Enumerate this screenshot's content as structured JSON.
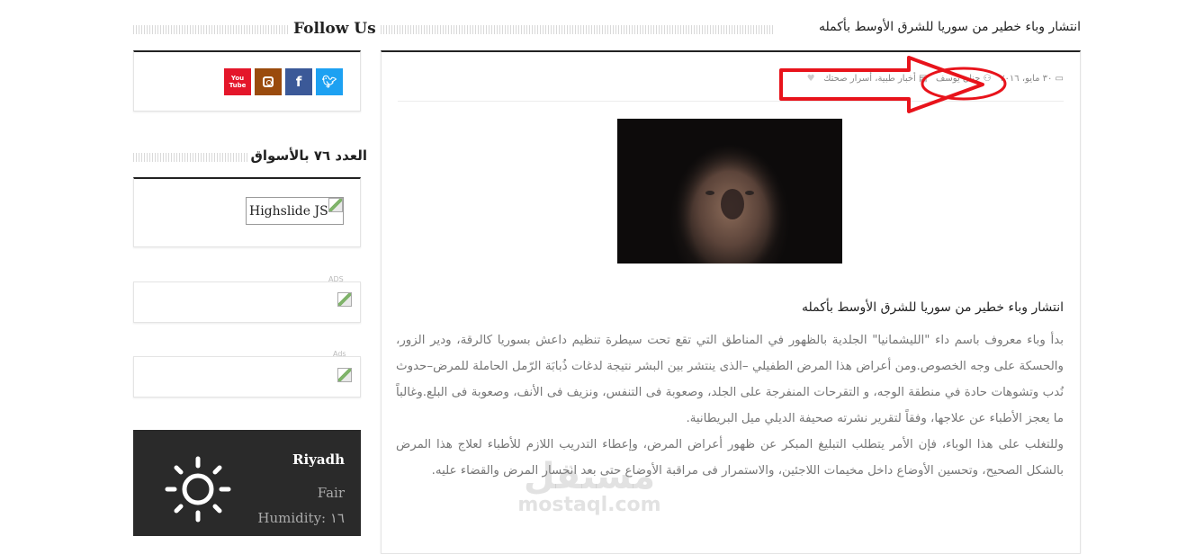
{
  "sidebar": {
    "follow_title": "Follow Us",
    "social": [
      {
        "name": "youtube",
        "label": "You Tube",
        "color": "#e4162a"
      },
      {
        "name": "instagram",
        "label": "◙",
        "color": "#9a4b0d"
      },
      {
        "name": "facebook",
        "label": "f",
        "color": "#3b5998"
      },
      {
        "name": "twitter",
        "label": "t",
        "color": "#1da1f2"
      }
    ],
    "issue_title": "العدد ٧٦ بالأسواق",
    "highslide_alt": "Highslide JS",
    "ads_label_1": "ADS",
    "ads_label_2": "Ads",
    "weather": {
      "city": "Riyadh",
      "condition": "Fair",
      "humidity": "Humidity: ١٦",
      "icon": "sun-icon"
    }
  },
  "article": {
    "header_title": "انتشار وباء خطير من سوريا للشرق الأوسط بأكمله",
    "date": "٣٠ مايو، ٢٠١٦",
    "author": "حنان يوسف",
    "categories": "أخبار طبية، أسرار صحتك",
    "inner_title": "انتشار وباء خطير من سوريا للشرق الأوسط بأكمله",
    "paragraphs": [
      "بدأ وباء معروف باسم داء \"الليشمانيا\" الجلدية بالظهور في المناطق التي تقع تحت سيطرة تنظيم داعش بسوريا كالرقة، ودير الزور، والحسكة على وجه الخصوص.ومن أعراض هذا المرض الطفيلي –الذى ينتشر بين البشر نتيجة لدغات ذُبابَة الرّمل الحاملة للمرض–حدوث نُدب وتشوهات حادة في منطقة الوجه، و التقرحات المنفرجة على الجلد، وصعوبة فى التنفس، ونزيف فى الأنف، وصعوبة فى البلع.وغالباً ما يعجز الأطباء عن علاجها، وفقاً لتقرير نشرته صحيفة الديلي ميل البريطانية.",
      "وللتغلب على هذا الوباء، فإن الأمر يتطلب التبليغ المبكر عن ظهور أعراض المرض، وإعطاء التدريب اللازم للأطباء لعلاج هذا المرض بالشكل الصحيح، وتحسين الأوضاع داخل مخيمات اللاجئين، والاستمرار فى مراقبة الأوضاع حتى بعد انحسار المرض والقضاء عليه."
    ]
  },
  "watermark": {
    "arabic": "مستقل",
    "latin": "mostaql.com"
  }
}
